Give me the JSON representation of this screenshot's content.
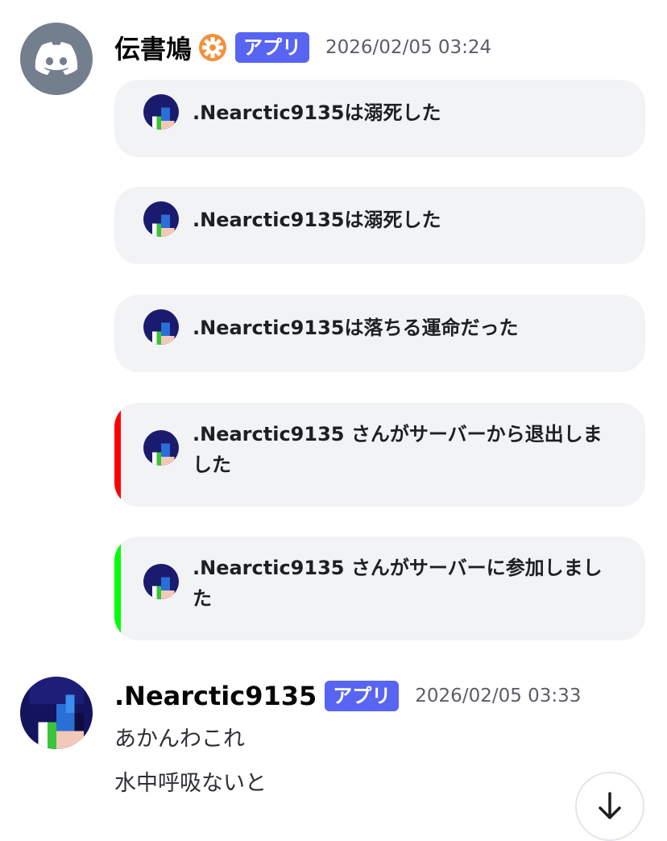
{
  "messages": [
    {
      "username": "伝書鳩",
      "badge": "アプリ",
      "timestamp": "2026/02/05 03:24",
      "embeds": [
        {
          "text": ".Nearctic9135は溺死した",
          "accent": null
        },
        {
          "text": ".Nearctic9135は溺死した",
          "accent": null
        },
        {
          "text": ".Nearctic9135は落ちる運命だった",
          "accent": null
        },
        {
          "text": ".Nearctic9135 さんがサーバーから退出しました",
          "accent": "#ff0000"
        },
        {
          "text": ".Nearctic9135 さんがサーバーに参加しました",
          "accent": "#00ff00"
        }
      ]
    },
    {
      "username": ".Nearctic9135",
      "badge": "アプリ",
      "timestamp": "2026/02/05 03:33",
      "lines": [
        "あかんわこれ",
        "水中呼吸ないと"
      ]
    }
  ],
  "icons": {
    "bot_avatar": "discord-logo-icon",
    "gear": "gear-icon",
    "scroll": "arrow-down-icon"
  },
  "colors": {
    "badge": "#5865f2",
    "embed_bg": "#f2f3f5",
    "leave_accent": "#ff0000",
    "join_accent": "#00ff00"
  }
}
